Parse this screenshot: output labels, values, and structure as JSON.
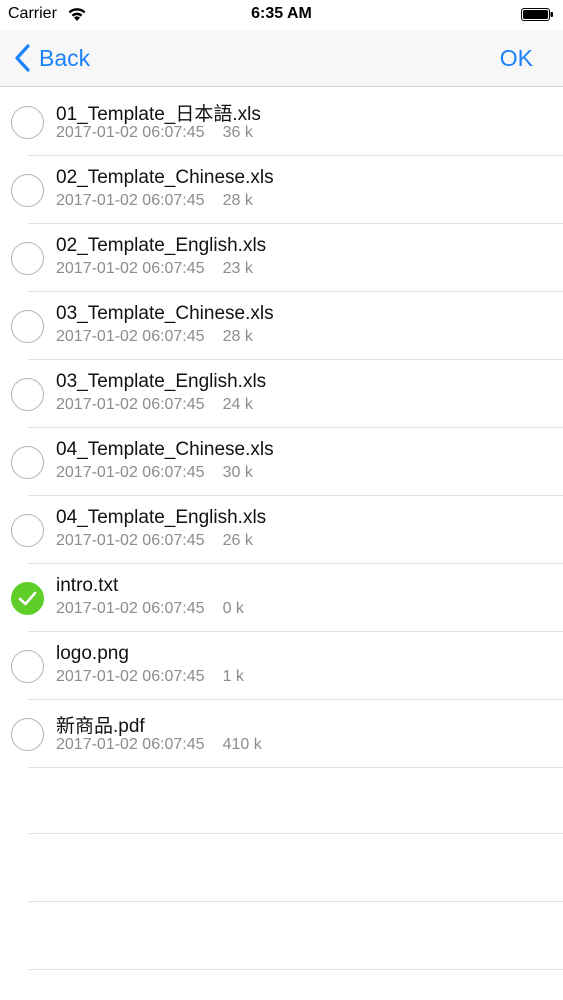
{
  "status_bar": {
    "carrier": "Carrier",
    "time": "6:35 AM",
    "icons": [
      "wifi-icon",
      "battery-icon"
    ]
  },
  "nav": {
    "back_label": "Back",
    "back_icon": "chevron-left-icon",
    "ok_label": "OK",
    "tint_color": "#1a82fb"
  },
  "files": [
    {
      "name": "01_Template_日本語.xls",
      "date": "2017-01-02 06:07:45",
      "size": "36 k",
      "selected": false
    },
    {
      "name": "02_Template_Chinese.xls",
      "date": "2017-01-02 06:07:45",
      "size": "28 k",
      "selected": false
    },
    {
      "name": "02_Template_English.xls",
      "date": "2017-01-02 06:07:45",
      "size": "23 k",
      "selected": false
    },
    {
      "name": "03_Template_Chinese.xls",
      "date": "2017-01-02 06:07:45",
      "size": "28 k",
      "selected": false
    },
    {
      "name": "03_Template_English.xls",
      "date": "2017-01-02 06:07:45",
      "size": "24 k",
      "selected": false
    },
    {
      "name": "04_Template_Chinese.xls",
      "date": "2017-01-02 06:07:45",
      "size": "30 k",
      "selected": false
    },
    {
      "name": "04_Template_English.xls",
      "date": "2017-01-02 06:07:45",
      "size": "26 k",
      "selected": false
    },
    {
      "name": "intro.txt",
      "date": "2017-01-02 06:07:45",
      "size": "0 k",
      "selected": true
    },
    {
      "name": "logo.png",
      "date": "2017-01-02 06:07:45",
      "size": "1 k",
      "selected": false
    },
    {
      "name": "新商品.pdf",
      "date": "2017-01-02 06:07:45",
      "size": "410 k",
      "selected": false
    }
  ],
  "colors": {
    "checked": "#5fce28",
    "unchecked_border": "#b3b3b3",
    "meta_text": "#8c8c8c"
  }
}
